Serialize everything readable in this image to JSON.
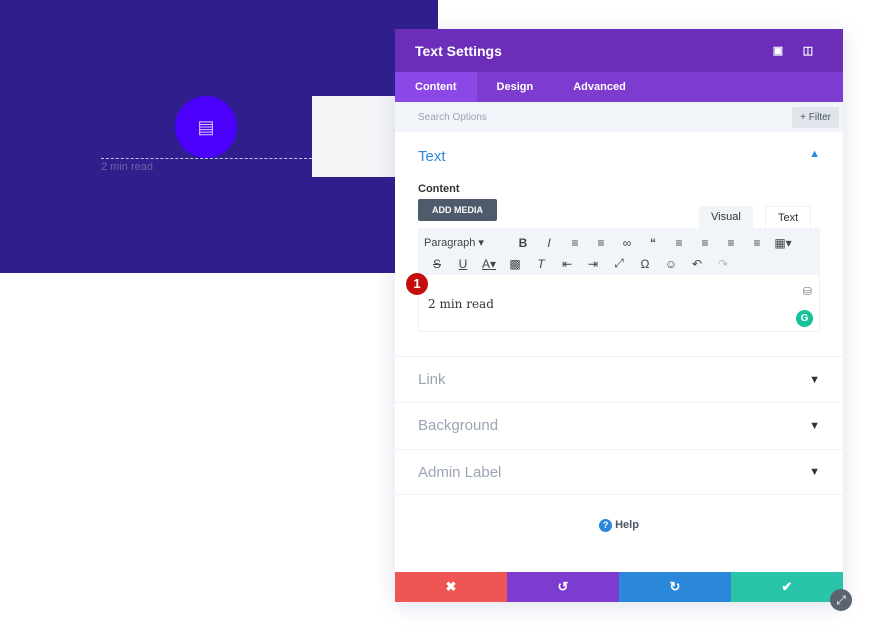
{
  "preview": {
    "text": "2 min read",
    "icon": "document-icon",
    "bg_color": "#2f1f8c",
    "circle_color": "#4a00fb"
  },
  "panel": {
    "title": "Text Settings",
    "tabs": [
      {
        "label": "Content",
        "active": true
      },
      {
        "label": "Design"
      },
      {
        "label": "Advanced"
      }
    ],
    "search_placeholder": "Search Options",
    "filter_label": "+ Filter",
    "section_title": "Text",
    "content_label": "Content",
    "add_media_label": "ADD MEDIA",
    "editor_tabs": [
      "Visual",
      "Text"
    ],
    "paragraph_select": "Paragraph",
    "editor_content": "2 min read",
    "badge": "1",
    "accordions": [
      "Link",
      "Background",
      "Admin Label"
    ],
    "help_label": "Help",
    "footer_colors": {
      "cancel": "#ef5555",
      "undo": "#7e3bd0",
      "redo": "#2b87da",
      "save": "#29c4a9"
    }
  }
}
